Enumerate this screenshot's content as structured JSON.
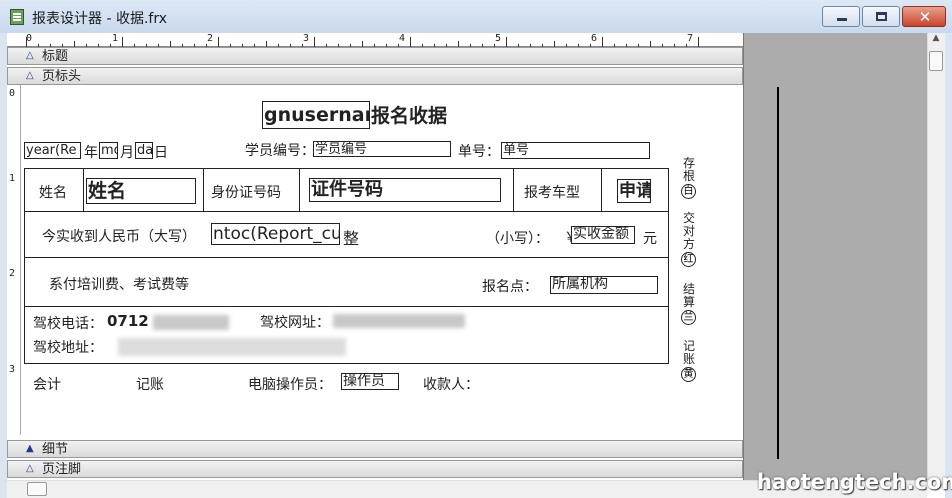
{
  "window": {
    "title": "报表设计器 - 收据.frx",
    "close_glyph": "✕"
  },
  "ruler": {
    "h_labels": [
      "0",
      "1",
      "2",
      "3",
      "4",
      "5",
      "6",
      "7"
    ],
    "v_labels": [
      "0",
      "1",
      "2",
      "3"
    ]
  },
  "bands": {
    "title": "标题",
    "page_header": "页标头",
    "detail": "细节",
    "page_footer": "页注脚"
  },
  "report": {
    "header_field": "gnusernar",
    "header_text": "报名收据",
    "date": {
      "year_field": "year(Re",
      "year": "年",
      "month_field": "mo",
      "month": "月",
      "day_field": "da",
      "day": "日"
    },
    "student_no_label": "学员编号：",
    "student_no_field": "学员编号",
    "receipt_no_label": "单号：",
    "receipt_no_field": "单号",
    "name_label": "姓名",
    "name_field": "姓名",
    "id_label": "身份证号码",
    "id_field": "证件号码",
    "car_type_label": "报考车型",
    "car_type_field": "申请",
    "received_label": "今实收到人民币（大写）",
    "received_field": "ntoc(Report_cu",
    "received_suffix": "整",
    "small_label": "（小写）：",
    "currency": "￥",
    "amount_field": "实收金额",
    "yuan": "元",
    "fee_text": "系付培训费、考试费等",
    "place_label": "报名点：",
    "place_field": "所属机构",
    "phone_label": "驾校电话：",
    "phone_value": "0712",
    "web_label": "驾校网址：",
    "addr_label": "驾校地址：",
    "accountant": "会计",
    "bookkeeper": "记账",
    "operator_label": "电脑操作员：",
    "operator_field": "操作员",
    "payee_label": "收款人："
  },
  "side": {
    "copy1": [
      "存",
      "根",
      "白"
    ],
    "copy2": [
      "交",
      "对",
      "方",
      "红"
    ],
    "copy3": [
      "结",
      "算",
      "兰"
    ],
    "copy4": [
      "记",
      "账",
      "黄"
    ]
  },
  "watermark": "haotengtech.com"
}
